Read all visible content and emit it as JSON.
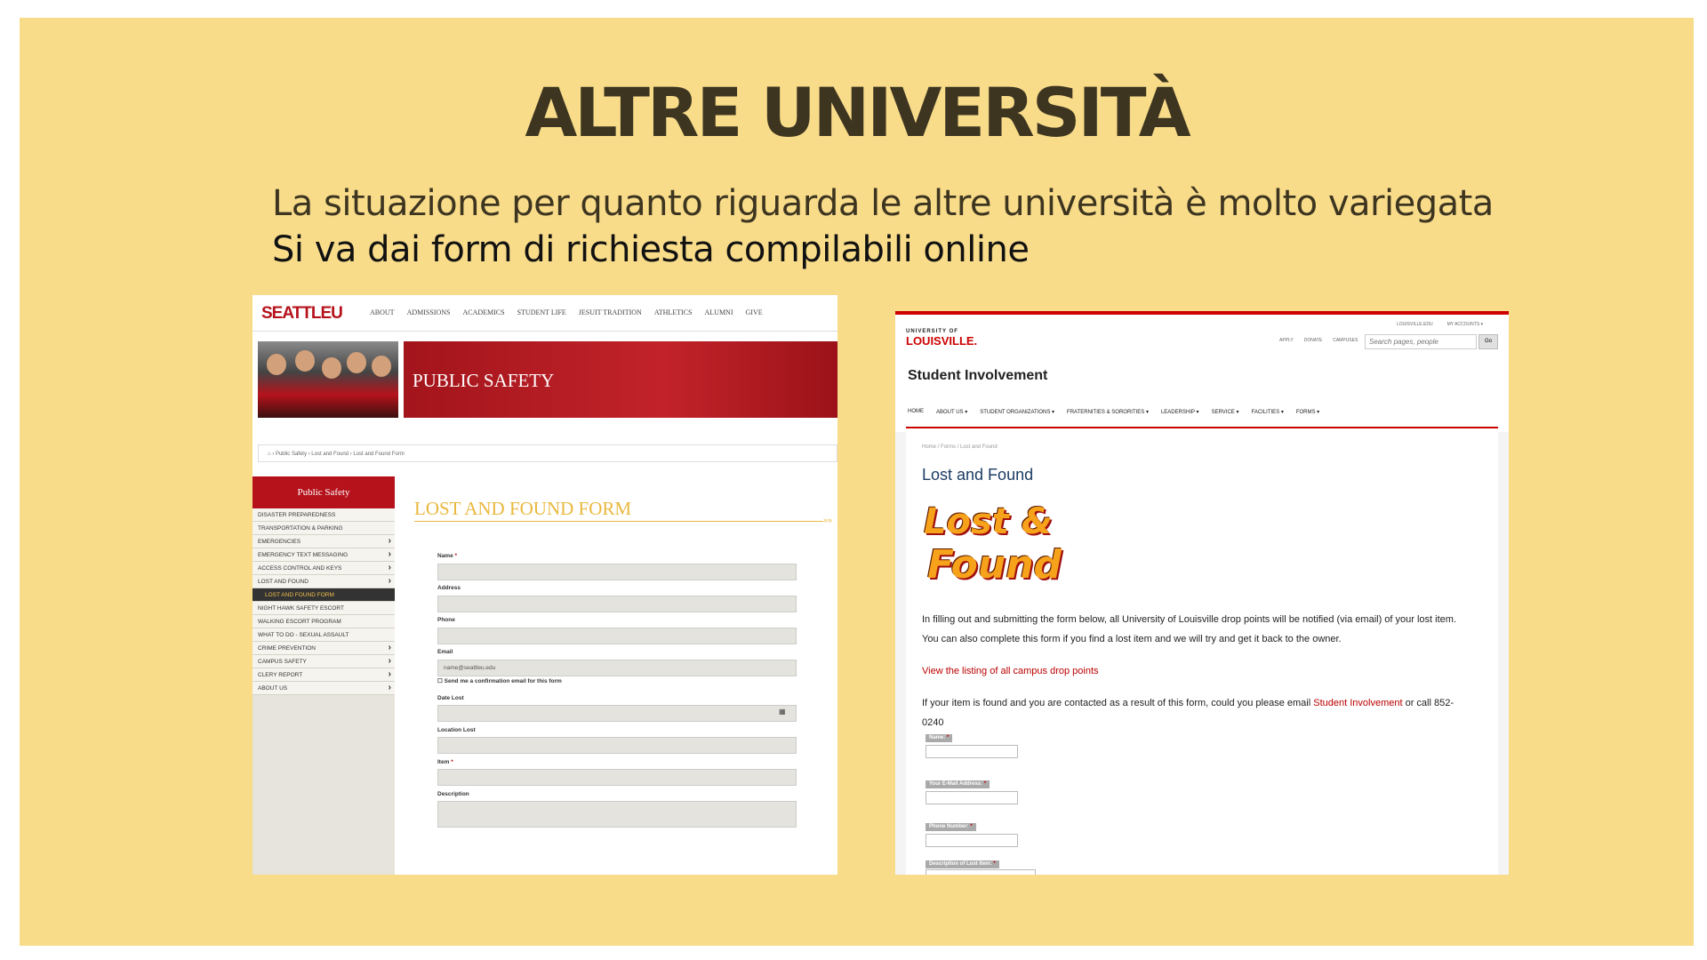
{
  "slide": {
    "title": "ALTRE UNIVERSITÀ",
    "line1": "La situazione per quanto riguarda le altre università è molto variegata",
    "line2": "Si va dai form di richiesta compilabili online"
  },
  "seattle": {
    "logo": "SEATTLEU",
    "nav": [
      "ABOUT",
      "ADMISSIONS",
      "ACADEMICS",
      "STUDENT LIFE",
      "JESUIT TRADITION",
      "ATHLETICS",
      "ALUMNI",
      "GIVE"
    ],
    "banner_title": "PUBLIC SAFETY",
    "breadcrumb": "⌂  ›  Public Safety  ›  Lost and Found  ›  Lost and Found Form",
    "sidebar_title": "Public Safety",
    "sidebar": [
      {
        "label": "DISASTER PREPAREDNESS",
        "chevron": false
      },
      {
        "label": "TRANSPORTATION & PARKING",
        "chevron": false
      },
      {
        "label": "EMERGENCIES",
        "chevron": true
      },
      {
        "label": "EMERGENCY TEXT MESSAGING",
        "chevron": true
      },
      {
        "label": "ACCESS CONTROL AND KEYS",
        "chevron": true
      },
      {
        "label": "LOST AND FOUND",
        "chevron": true
      },
      {
        "label": "LOST AND FOUND FORM",
        "chevron": false,
        "active": true
      },
      {
        "label": "NIGHT HAWK SAFETY ESCORT",
        "chevron": false
      },
      {
        "label": "WALKING ESCORT PROGRAM",
        "chevron": false
      },
      {
        "label": "WHAT TO DO - SEXUAL ASSAULT",
        "chevron": false
      },
      {
        "label": "CRIME PREVENTION",
        "chevron": true
      },
      {
        "label": "CAMPUS SAFETY",
        "chevron": true
      },
      {
        "label": "CLERY REPORT",
        "chevron": true
      },
      {
        "label": "ABOUT US",
        "chevron": true
      }
    ],
    "form_title": "LOST AND FOUND FORM",
    "fields": {
      "name": "Name",
      "address": "Address",
      "phone": "Phone",
      "email": "Email",
      "email_placeholder": "name@seattleu.edu",
      "confirm": "Send me a confirmation email for this form",
      "date_lost": "Date Lost",
      "location_lost": "Location Lost",
      "item": "Item",
      "description": "Description"
    }
  },
  "louisville": {
    "logo_small": "UNIVERSITY OF",
    "logo": "LOUISVILLE.",
    "top_links": [
      "LOUISVILLE.EDU",
      "MY ACCOUNTS ▾"
    ],
    "sub_links": [
      "APPLY",
      "DONATE",
      "CAMPUSES"
    ],
    "search_placeholder": "Search pages, people",
    "go": "Go",
    "site_title": "Student Involvement",
    "nav": [
      "HOME",
      "ABOUT US ▾",
      "STUDENT ORGANIZATIONS ▾",
      "FRATERNITIES & SORORITIES ▾",
      "LEADERSHIP ▾",
      "SERVICE ▾",
      "FACILITIES ▾",
      "FORMS ▾"
    ],
    "breadcrumb": "Home /  Forms /  Lost and Found",
    "heading": "Lost and Found",
    "graphic_line1": "Lost &",
    "graphic_line2": "Found",
    "para1": "In filling out and submitting the form below, all University of Louisville drop points will be notified (via email) of your lost item.",
    "para2": "You can also complete this form if you find a lost item and we will try and get it back to the owner.",
    "drop_link": "View the listing of all campus drop points",
    "para3_a": "If your item is found and you are contacted as a result of this form, could you please email ",
    "para3_link": "Student Involvement",
    "para3_b": " or call 852-",
    "para3_c": "0240",
    "form_labels": [
      "Name:",
      "Your E-Mail Address:",
      "Phone Number:",
      "Description of Lost Item:"
    ]
  }
}
